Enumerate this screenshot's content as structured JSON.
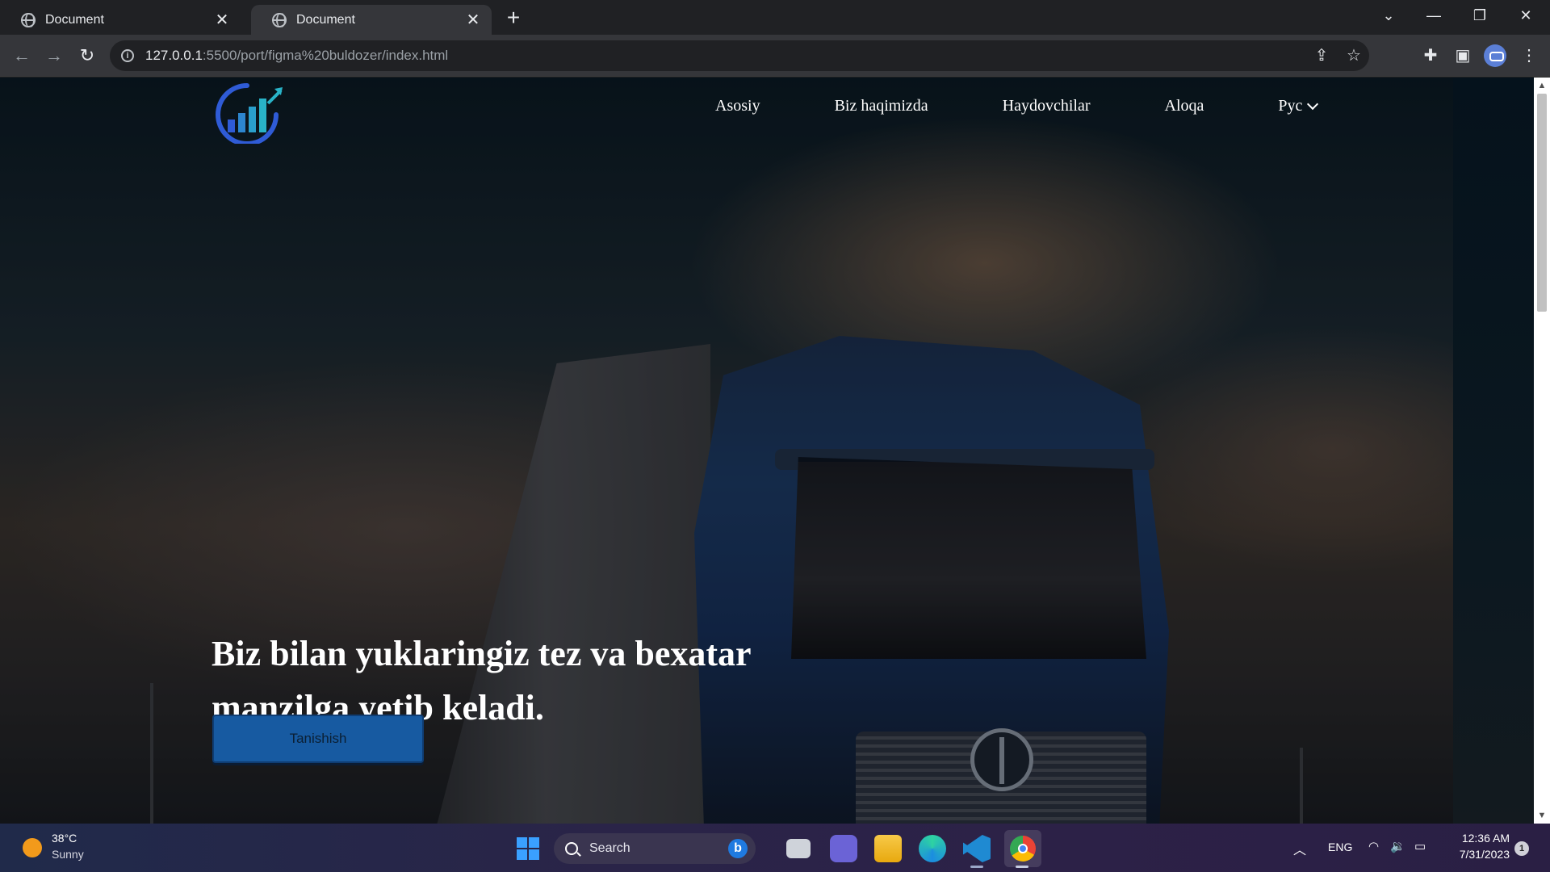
{
  "browser": {
    "tabs": [
      {
        "title": "Document",
        "active": false
      },
      {
        "title": "Document",
        "active": true
      }
    ],
    "new_tab_glyph": "+",
    "address": {
      "host": "127.0.0.1",
      "path": ":5500/port/figma%20buldozer/index.html"
    }
  },
  "site": {
    "nav": [
      "Asosiy",
      "Biz haqimizda",
      "Haydovchilar",
      "Aloqa",
      "Рус"
    ],
    "hero": {
      "title": "Biz bilan yuklaringiz tez va bexatar manzilga yetib keladi.",
      "button": "Tanishish"
    },
    "colors": {
      "button": "#175aa1",
      "logo_blue": "#2f5bd6",
      "logo_teal": "#29b3c8"
    }
  },
  "taskbar": {
    "weather": {
      "temp": "38°C",
      "desc": "Sunny"
    },
    "search_label": "Search",
    "language": "ENG",
    "time": "12:36 AM",
    "date": "7/31/2023",
    "notifications": "1"
  }
}
